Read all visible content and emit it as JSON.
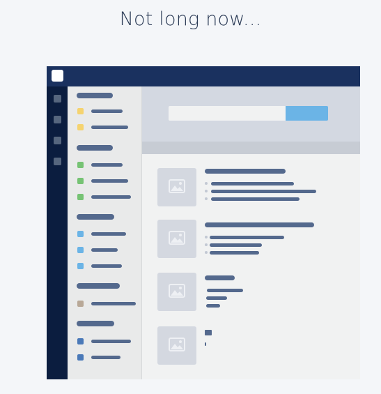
{
  "headline": "Not long now...",
  "colors": {
    "page_bg": "#f4f6f9",
    "topbar": "#1a315f",
    "rail": "#0b1d3f",
    "sidebar": "#e9eaea",
    "placeholder_line": "#54698d",
    "search_button": "#6bb4e6",
    "hero": "#d3d8e1",
    "yellow": "#f5d36f",
    "green": "#76c374",
    "blue": "#6bb4e6",
    "tan": "#b8a897",
    "navy": "#4a79b8"
  },
  "icons": {
    "logo": "app-logo-icon",
    "image_placeholder": "image-placeholder-icon"
  },
  "sidebar": {
    "sections": [
      {
        "color": "yellow",
        "items": 2
      },
      {
        "color": "green",
        "items": 3
      },
      {
        "color": "blue",
        "items": 3
      },
      {
        "color": "tan",
        "items": 1
      },
      {
        "color": "navy",
        "items": 2
      }
    ]
  },
  "search": {
    "placeholder": ""
  }
}
